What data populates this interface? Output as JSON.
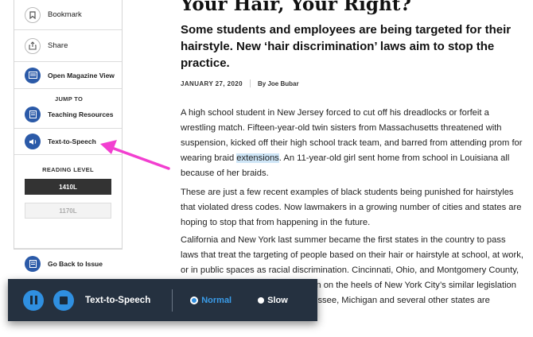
{
  "sidebar": {
    "bookmark_label": "Bookmark",
    "share_label": "Share",
    "magazine_label": "Open Magazine View",
    "jump_to_label": "JUMP TO",
    "teaching_label": "Teaching Resources",
    "tts_label": "Text-to-Speech",
    "reading_level_title": "READING LEVEL",
    "levels": [
      "1410L",
      "1170L"
    ],
    "back_label": "Go Back to Issue"
  },
  "article": {
    "headline": "Your Hair, Your Right?",
    "dek": "Some students and employees are being targeted for their hairstyle. New ‘hair discrimination’ laws aim to stop the practice.",
    "date": "JANUARY 27, 2020",
    "author": "By Joe Bubar",
    "p1_before": "A high school student in New Jersey forced to cut off his dreadlocks or forfeit a wrestling match. Fifteen-year-old twin sisters from Massachusetts threatened with suspension, kicked off their high school track team, and barred from attending prom for wearing braid ",
    "p1_highlight": "extensions",
    "p1_after": ". An 11-year-old girl sent home from school in Louisiana all because of her braids.",
    "p2": "These are just a few recent examples of black students being punished for hairstyles that violated dress codes. Now lawmakers in a growing number of cities and states are hoping to stop that from happening in the future.",
    "p3": "California and New York last summer became the first states in the country to pass laws that treat the targeting of people based on their hair or hairstyle at school, at work, or in public spaces as racial discrimination. Cincinnati, Ohio, and Montgomery County, Maryland, passed similar legislation on the heels of New York City’s similar legislation last winter. And New Jersey, Tennessee, Michigan and several other states are considering doing the same."
  },
  "tts_bar": {
    "label": "Text-to-Speech",
    "options": [
      "Normal",
      "Slow"
    ],
    "selected": "Normal"
  },
  "colors": {
    "accent_blue": "#2b5aa8",
    "toolbar_bg": "#253140",
    "annotation_arrow": "#f23fd0",
    "highlight": "#cfe6f7"
  }
}
